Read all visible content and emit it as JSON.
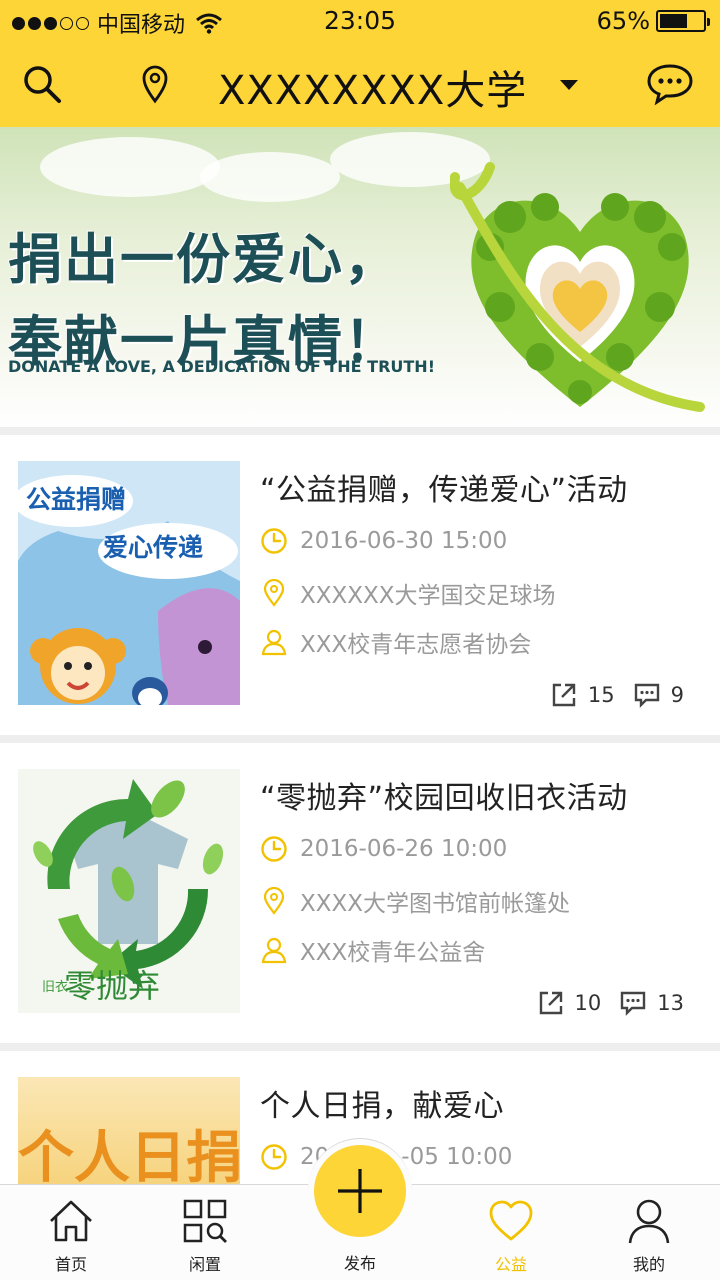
{
  "status_bar": {
    "carrier": "中国移动",
    "time": "23:05",
    "battery": "65%",
    "battery_level": 0.65
  },
  "header": {
    "title": "XXXXXXXX大学"
  },
  "banner": {
    "line1": "捐出一份爱心，",
    "line2": "奉献一片真情！",
    "subtitle": "DONATE A LOVE, A DEDICATION OF THE TRUTH!"
  },
  "events": [
    {
      "title": "“公益捐赠，传递爱心”活动",
      "time": "2016-06-30 15:00",
      "location": "XXXXXX大学国交足球场",
      "organizer": "XXX校青年志愿者协会",
      "shares": "15",
      "comments": "9",
      "thumb_text_1": "公益捐赠",
      "thumb_text_2": "爱心传递"
    },
    {
      "title": "“零抛弃”校园回收旧衣活动",
      "time": "2016-06-26 10:00",
      "location": "XXXX大学图书馆前帐篷处",
      "organizer": "XXX校青年公益舍",
      "shares": "10",
      "comments": "13",
      "thumb_text_1": "零抛弃",
      "thumb_text_2": "旧衣"
    },
    {
      "title": "个人日捐，献爱心",
      "time": "20",
      "time_tail": "-05 10:00",
      "thumb_text_1": "个人日捐"
    }
  ],
  "tabbar": {
    "items": [
      {
        "label": "首页",
        "icon": "home-icon"
      },
      {
        "label": "闲置",
        "icon": "grid-search-icon"
      },
      {
        "label": "发布",
        "icon": "plus-icon"
      },
      {
        "label": "公益",
        "icon": "heart-icon",
        "active": true
      },
      {
        "label": "我的",
        "icon": "person-icon"
      }
    ]
  },
  "colors": {
    "brand_yellow": "#fdd537",
    "active_tab": "#f2c200",
    "meta_gray": "#9a9a9a"
  }
}
